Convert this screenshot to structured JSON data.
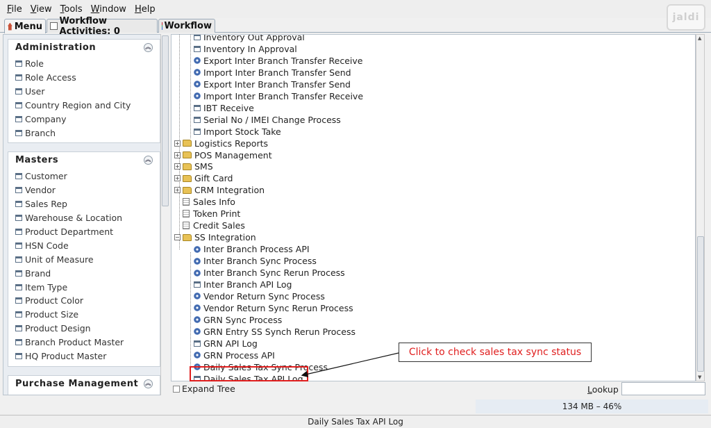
{
  "menubar": {
    "items": [
      {
        "pre": "",
        "key": "F",
        "post": "ile"
      },
      {
        "pre": "",
        "key": "V",
        "post": "iew"
      },
      {
        "pre": "",
        "key": "T",
        "post": "ools"
      },
      {
        "pre": "",
        "key": "W",
        "post": "indow"
      },
      {
        "pre": "",
        "key": "H",
        "post": "elp"
      }
    ]
  },
  "logo_text": "jaldi",
  "tabs": [
    {
      "label": "Menu",
      "icon": "home-icon"
    },
    {
      "label": "Workflow Activities: 0",
      "icon": "document-icon"
    },
    {
      "label": "Workflow",
      "icon": "workflow-icon"
    }
  ],
  "sidebar": {
    "sections": [
      {
        "title": "Administration",
        "items": [
          "Role",
          "Role Access",
          "User",
          "Country Region and City",
          "Company",
          "Branch"
        ]
      },
      {
        "title": "Masters",
        "items": [
          "Customer",
          "Vendor",
          "Sales Rep",
          "Warehouse & Location",
          "Product Department",
          "HSN Code",
          "Unit of Measure",
          "Brand",
          "Item Type",
          "Product Color",
          "Product Size",
          "Product Design",
          "Branch Product Master",
          "HQ Product Master"
        ]
      },
      {
        "title": "Purchase Management",
        "items": []
      }
    ]
  },
  "tree": {
    "rows": [
      {
        "label": "Inventory Out Approval",
        "icon": "window"
      },
      {
        "label": "Inventory In Approval",
        "icon": "window"
      },
      {
        "label": "Export Inter Branch Transfer Receive",
        "icon": "gear"
      },
      {
        "label": "Import Inter Branch Transfer Send",
        "icon": "gear"
      },
      {
        "label": "Export Inter Branch Transfer Send",
        "icon": "gear"
      },
      {
        "label": "Import Inter Branch Transfer Receive",
        "icon": "gear"
      },
      {
        "label": "IBT Receive",
        "icon": "window"
      },
      {
        "label": "Serial No / IMEI Change Process",
        "icon": "window"
      },
      {
        "label": "Import Stock Take",
        "icon": "window"
      },
      {
        "label": "Logistics Reports",
        "icon": "folder"
      },
      {
        "label": "POS Management",
        "icon": "folder"
      },
      {
        "label": "SMS",
        "icon": "folder"
      },
      {
        "label": "Gift Card",
        "icon": "folder"
      },
      {
        "label": "CRM Integration",
        "icon": "folder"
      },
      {
        "label": "Sales Info",
        "icon": "page"
      },
      {
        "label": "Token Print",
        "icon": "page"
      },
      {
        "label": "Credit Sales",
        "icon": "page"
      },
      {
        "label": "SS Integration",
        "icon": "folder-open"
      },
      {
        "label": "Inter Branch Process API",
        "icon": "gear"
      },
      {
        "label": "Inter Branch Sync Process",
        "icon": "gear"
      },
      {
        "label": "Inter Branch Sync Rerun Process",
        "icon": "gear"
      },
      {
        "label": "Inter Branch API Log",
        "icon": "window"
      },
      {
        "label": "Vendor Return Sync Process",
        "icon": "gear"
      },
      {
        "label": "Vendor Return Sync Rerun Process",
        "icon": "gear"
      },
      {
        "label": "GRN Sync Process",
        "icon": "gear"
      },
      {
        "label": "GRN Entry SS Synch Rerun Process",
        "icon": "gear"
      },
      {
        "label": "GRN API Log",
        "icon": "window"
      },
      {
        "label": "GRN Process API",
        "icon": "gear"
      },
      {
        "label": "Daily Sales Tax Sync Process",
        "icon": "gear"
      },
      {
        "label": "Daily Sales Tax API Log",
        "icon": "window"
      }
    ]
  },
  "callout": {
    "text": "Click to check sales tax sync status",
    "color": "#e01e1e"
  },
  "bottom": {
    "expand_tree": "Expand Tree",
    "lookup_pre": "",
    "lookup_key": "L",
    "lookup_post": "ookup",
    "memory": "134 MB – 46%",
    "status": "Daily Sales Tax API Log"
  }
}
